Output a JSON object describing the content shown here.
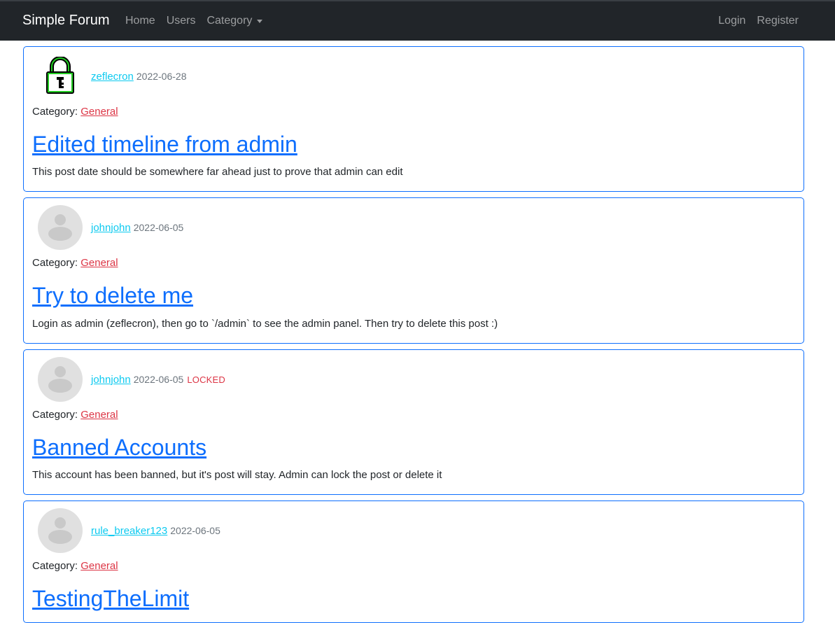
{
  "navbar": {
    "brand": "Simple Forum",
    "links": [
      "Home",
      "Users",
      "Category"
    ],
    "right_links": [
      "Login",
      "Register"
    ],
    "bg_color": "#212529"
  },
  "category_label": "Category:",
  "posts": [
    {
      "author": "zeflecron",
      "date": "2022-06-28",
      "avatar": "lock-icon",
      "category": "General",
      "title": "Edited timeline from admin",
      "body": "This post date should be somewhere far ahead just to prove that admin can edit"
    },
    {
      "author": "johnjohn",
      "date": "2022-06-05",
      "avatar": "default-user-avatar",
      "category": "General",
      "title": "Try to delete me",
      "body": "Login as admin (zeflecron), then go to `/admin` to see the admin panel. Then try to delete this post :)"
    },
    {
      "author": "johnjohn",
      "date": "2022-06-05",
      "status": "LOCKED",
      "avatar": "default-user-avatar",
      "category": "General",
      "title": "Banned Accounts",
      "body": "This account has been banned, but it's post will stay. Admin can lock the post or delete it"
    },
    {
      "author": "rule_breaker123",
      "date": "2022-06-05",
      "avatar": "default-user-avatar",
      "category": "General",
      "title": "TestingTheLimit"
    }
  ],
  "colors": {
    "post_border": "#0d6efd",
    "title_link": "#0d6efd",
    "user_link": "#0dcaf0",
    "category_link": "#dc3545",
    "locked": "#dc3545"
  }
}
